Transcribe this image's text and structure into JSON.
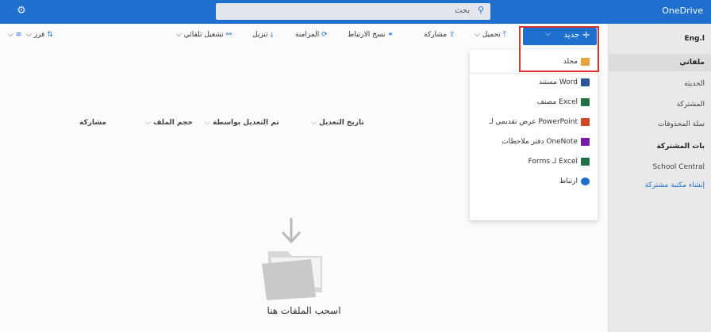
{
  "topbar": {
    "brand": "OneDrive",
    "search_placeholder": "بحث"
  },
  "sidebar": {
    "items": [
      {
        "label": "Eng.l",
        "style": "bold"
      },
      {
        "label": "ملفاتي",
        "style": "bold"
      },
      {
        "label": "الحديثة",
        "style": "normal"
      },
      {
        "label": "المشتركة",
        "style": "normal"
      },
      {
        "label": "سلة المحذوفات",
        "style": "normal"
      },
      {
        "label": "بات المشتركة",
        "style": "bold"
      },
      {
        "label": "School Central",
        "style": "normal"
      },
      {
        "label": "إنشاء مكتبة مشتركة",
        "style": "link"
      }
    ]
  },
  "cmdbar": {
    "new": "جديد",
    "upload": "تحميل",
    "share": "مشاركة",
    "copy_link": "نسخ الارتباط",
    "sync": "المزامنة",
    "download": "تنزيل",
    "automate": "تشغيل تلقائي",
    "sort": "فرز"
  },
  "new_menu": {
    "items": [
      {
        "label": "مجلد",
        "icon": "folder-icon",
        "color": "#e8a33d"
      },
      {
        "label": "مستند Word",
        "icon": "word-icon",
        "color": "#2b579a"
      },
      {
        "label": "مصنف Excel",
        "icon": "excel-icon",
        "color": "#217346"
      },
      {
        "label": "عرض تقديمي لـ PowerPoint",
        "icon": "powerpoint-icon",
        "color": "#d24726"
      },
      {
        "label": "دفتر ملاحظات OneNote",
        "icon": "onenote-icon",
        "color": "#7719aa"
      },
      {
        "label": "Forms لـ Excel",
        "icon": "forms-icon",
        "color": "#217346"
      },
      {
        "label": "ارتباط",
        "icon": "link-globe-icon",
        "color": "#1f6fcf"
      }
    ]
  },
  "columns": {
    "modified": "تاريخ التعديل",
    "modified_by": "تم التعديل بواسطة",
    "file_size": "حجم الملف",
    "sharing": "مشاركة"
  },
  "empty_state": {
    "message": "اسحب الملفات هنا"
  },
  "colors": {
    "accent": "#1f6fcf",
    "highlight": "#d9342b"
  }
}
